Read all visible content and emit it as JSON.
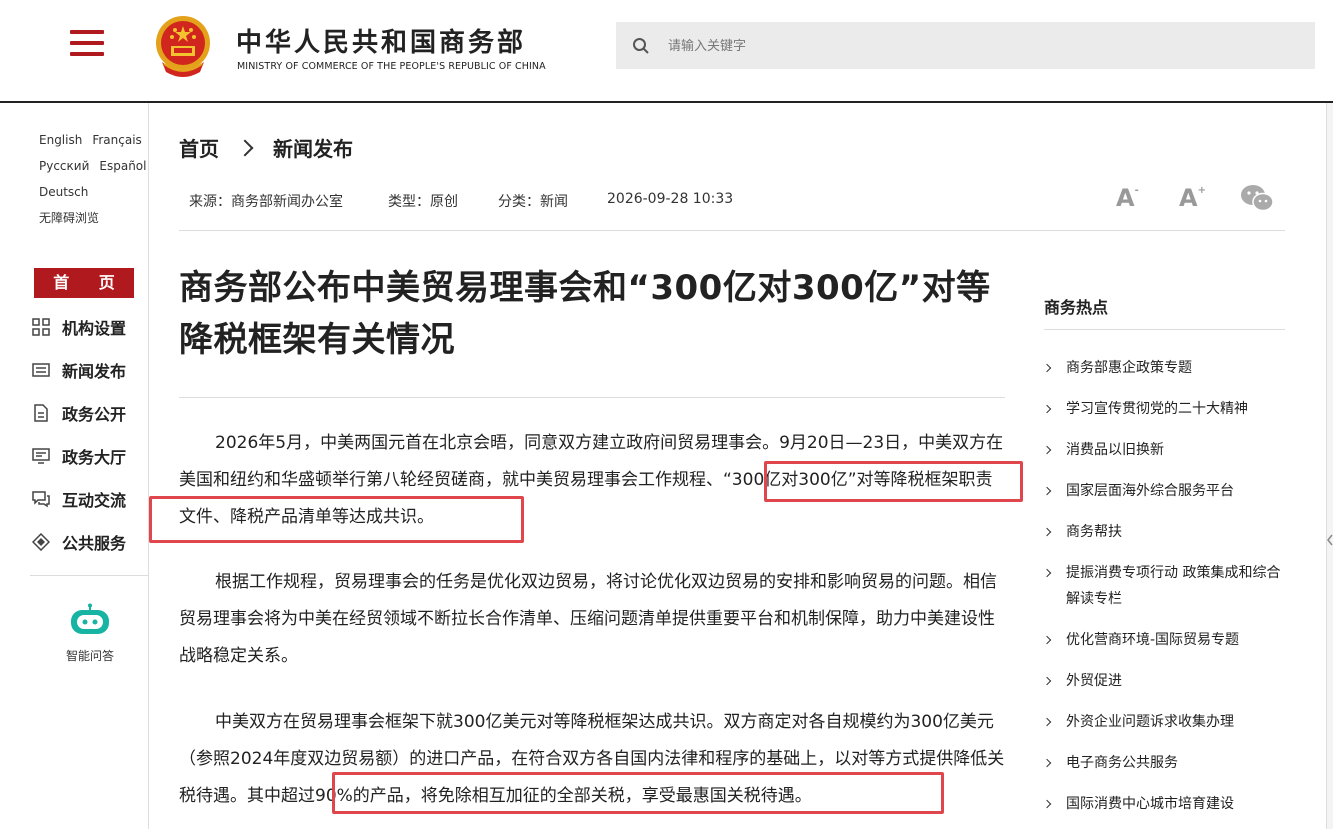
{
  "header": {
    "title_cn": "中华人民共和国商务部",
    "title_en": "MINISTRY OF COMMERCE OF THE PEOPLE'S REPUBLIC OF CHINA",
    "search_placeholder": "请输入关键字",
    "accent_color": "#b0191e"
  },
  "sidebar": {
    "languages": [
      "English",
      "Français",
      "Русский",
      "Español",
      "Deutsch",
      "无障碍浏览"
    ],
    "home": "首 页",
    "nav": [
      {
        "label": "机构设置",
        "icon": "org-grid-icon"
      },
      {
        "label": "新闻发布",
        "icon": "news-icon"
      },
      {
        "label": "政务公开",
        "icon": "document-icon"
      },
      {
        "label": "政务大厅",
        "icon": "hall-icon"
      },
      {
        "label": "互动交流",
        "icon": "chat-icon"
      },
      {
        "label": "公共服务",
        "icon": "service-icon"
      }
    ],
    "ai_label": "智能问答"
  },
  "breadcrumb": {
    "home": "首页",
    "current": "新闻发布"
  },
  "meta": {
    "source": "来源：商务部新闻办公室",
    "type": "类型：原创",
    "category": "分类：新闻",
    "datetime": "2026-09-28 10:33"
  },
  "article": {
    "title": "商务部公布中美贸易理事会和“300亿对300亿”对等降税框架有关情况",
    "paragraphs": [
      "2026年5月，中美两国元首在北京会晤，同意双方建立政府间贸易理事会。9月20日—23日，中美双方在美国和纽约和华盛顿举行第八轮经贸磋商，就中美贸易理事会工作规程、“300亿对300亿”对等降税框架职责文件、降税产品清单等达成共识。",
      "根据工作规程，贸易理事会的任务是优化双边贸易，将讨论优化双边贸易的安排和影响贸易的问题。相信贸易理事会将为中美在经贸领域不断拉长合作清单、压缩问题清单提供重要平台和机制保障，助力中美建设性战略稳定关系。",
      "中美双方在贸易理事会框架下就300亿美元对等降税框架达成共识。双方商定对各自规模约为300亿美元（参照2024年度双边贸易额）的进口产品，在符合双方各自国内法律和程序的基础上，以对等方式提供降低关税待遇。其中超过90%的产品，将免除相互加征的全部关税，享受最惠国关税待遇。"
    ]
  },
  "hot": {
    "title": "商务热点",
    "items": [
      "商务部惠企政策专题",
      "学习宣传贯彻党的二十大精神",
      "消费品以旧换新",
      "国家层面海外综合服务平台",
      "商务帮扶",
      "提振消费专项行动 政策集成和综合解读专栏",
      "优化营商环境-国际贸易专题",
      "外贸促进",
      "外资企业问题诉求收集办理",
      "电子商务公共服务",
      "国际消费中心城市培育建设"
    ]
  }
}
